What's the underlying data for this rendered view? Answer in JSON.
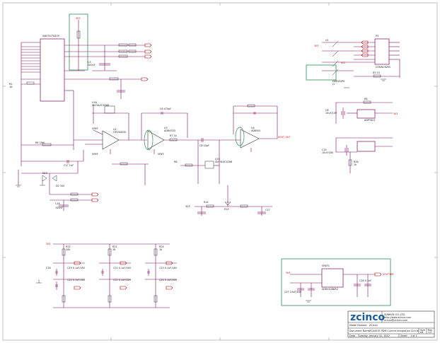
{
  "block_labels": {
    "mcu_part": "SI8035-TSSOP",
    "op_label": "OP",
    "op_reference": "U15",
    "op_title": "SSOP8-SMA",
    "power_supply_label": "3.3 MAIN_PWR",
    "output_net": "VOUT_OUT",
    "jumper_ref": "J1",
    "jumper_part": "HDR4SIPS",
    "connector_ref": "P3",
    "connector_part": "CONN-HDR5",
    "bottom_reg_ref": "VREF1",
    "bottom_reg_part": "ADR4528KRZ",
    "bottom_reg_output": "VOUT REF"
  },
  "title_block": {
    "company": "SUNRISE CO.,LTD.",
    "website": "http://www.zcinco.com",
    "email": "zcinco@zcinco.com",
    "logo_text": "zcinco",
    "row1_label": "Model Number",
    "row1_value": "ZCinco",
    "row2_label": "Document Name",
    "row2_value": "ZCA4535 PDM Current Integration Circuit",
    "size_label": "Size",
    "size_value": "A4",
    "rev_label": "Rev",
    "rev_value": "1.0",
    "date_label": "Date",
    "date_value": "Tuesday, January 31, 2012",
    "sheet_label": "Sheet",
    "sheet_value": "1 of 1"
  }
}
